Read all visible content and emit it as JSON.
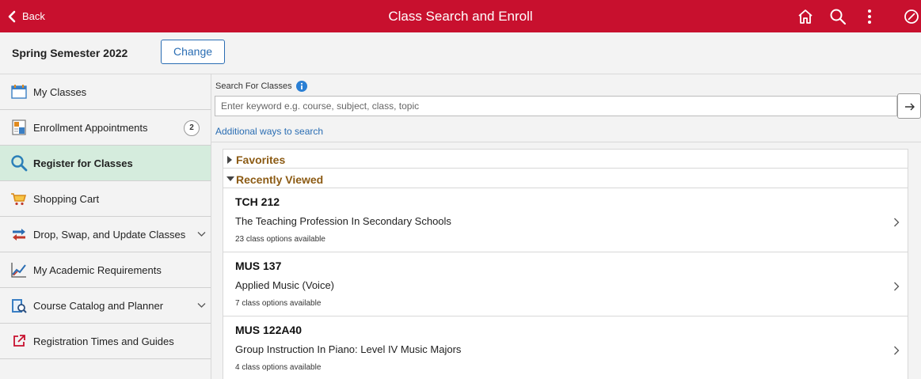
{
  "header": {
    "back_label": "Back",
    "title": "Class Search and Enroll",
    "bar_color": "#c8102e",
    "icons": [
      "home-icon",
      "search-icon",
      "more-actions-icon",
      "navbar-icon"
    ]
  },
  "term": {
    "name": "Spring Semester 2022",
    "change_label": "Change"
  },
  "sidebar": {
    "items": [
      {
        "label": "My Classes",
        "icon": "calendar-icon"
      },
      {
        "label": "Enrollment Appointments",
        "icon": "appointments-icon",
        "badge": "2"
      },
      {
        "label": "Register for Classes",
        "icon": "search-icon",
        "active": true
      },
      {
        "label": "Shopping Cart",
        "icon": "cart-icon"
      },
      {
        "label": "Drop, Swap, and Update Classes",
        "icon": "swap-arrows-icon",
        "expandable": true
      },
      {
        "label": "My Academic Requirements",
        "icon": "chart-line-icon"
      },
      {
        "label": "Course Catalog and Planner",
        "icon": "catalog-icon",
        "expandable": true
      },
      {
        "label": "Registration Times and Guides",
        "icon": "external-link-icon"
      }
    ]
  },
  "search": {
    "label": "Search For Classes",
    "placeholder": "Enter keyword e.g. course, subject, class, topic",
    "value": "",
    "additional_ways": "Additional ways to search"
  },
  "sections": {
    "favorites": "Favorites",
    "recently_viewed": "Recently Viewed"
  },
  "courses": [
    {
      "code": "TCH 212",
      "title": "The Teaching Profession In Secondary Schools",
      "options": "23 class options available"
    },
    {
      "code": "MUS 137",
      "title": "Applied Music (Voice)",
      "options": "7 class options available"
    },
    {
      "code": "MUS 122A40",
      "title": "Group Instruction In Piano: Level IV Music Majors",
      "options": "4 class options available"
    }
  ]
}
